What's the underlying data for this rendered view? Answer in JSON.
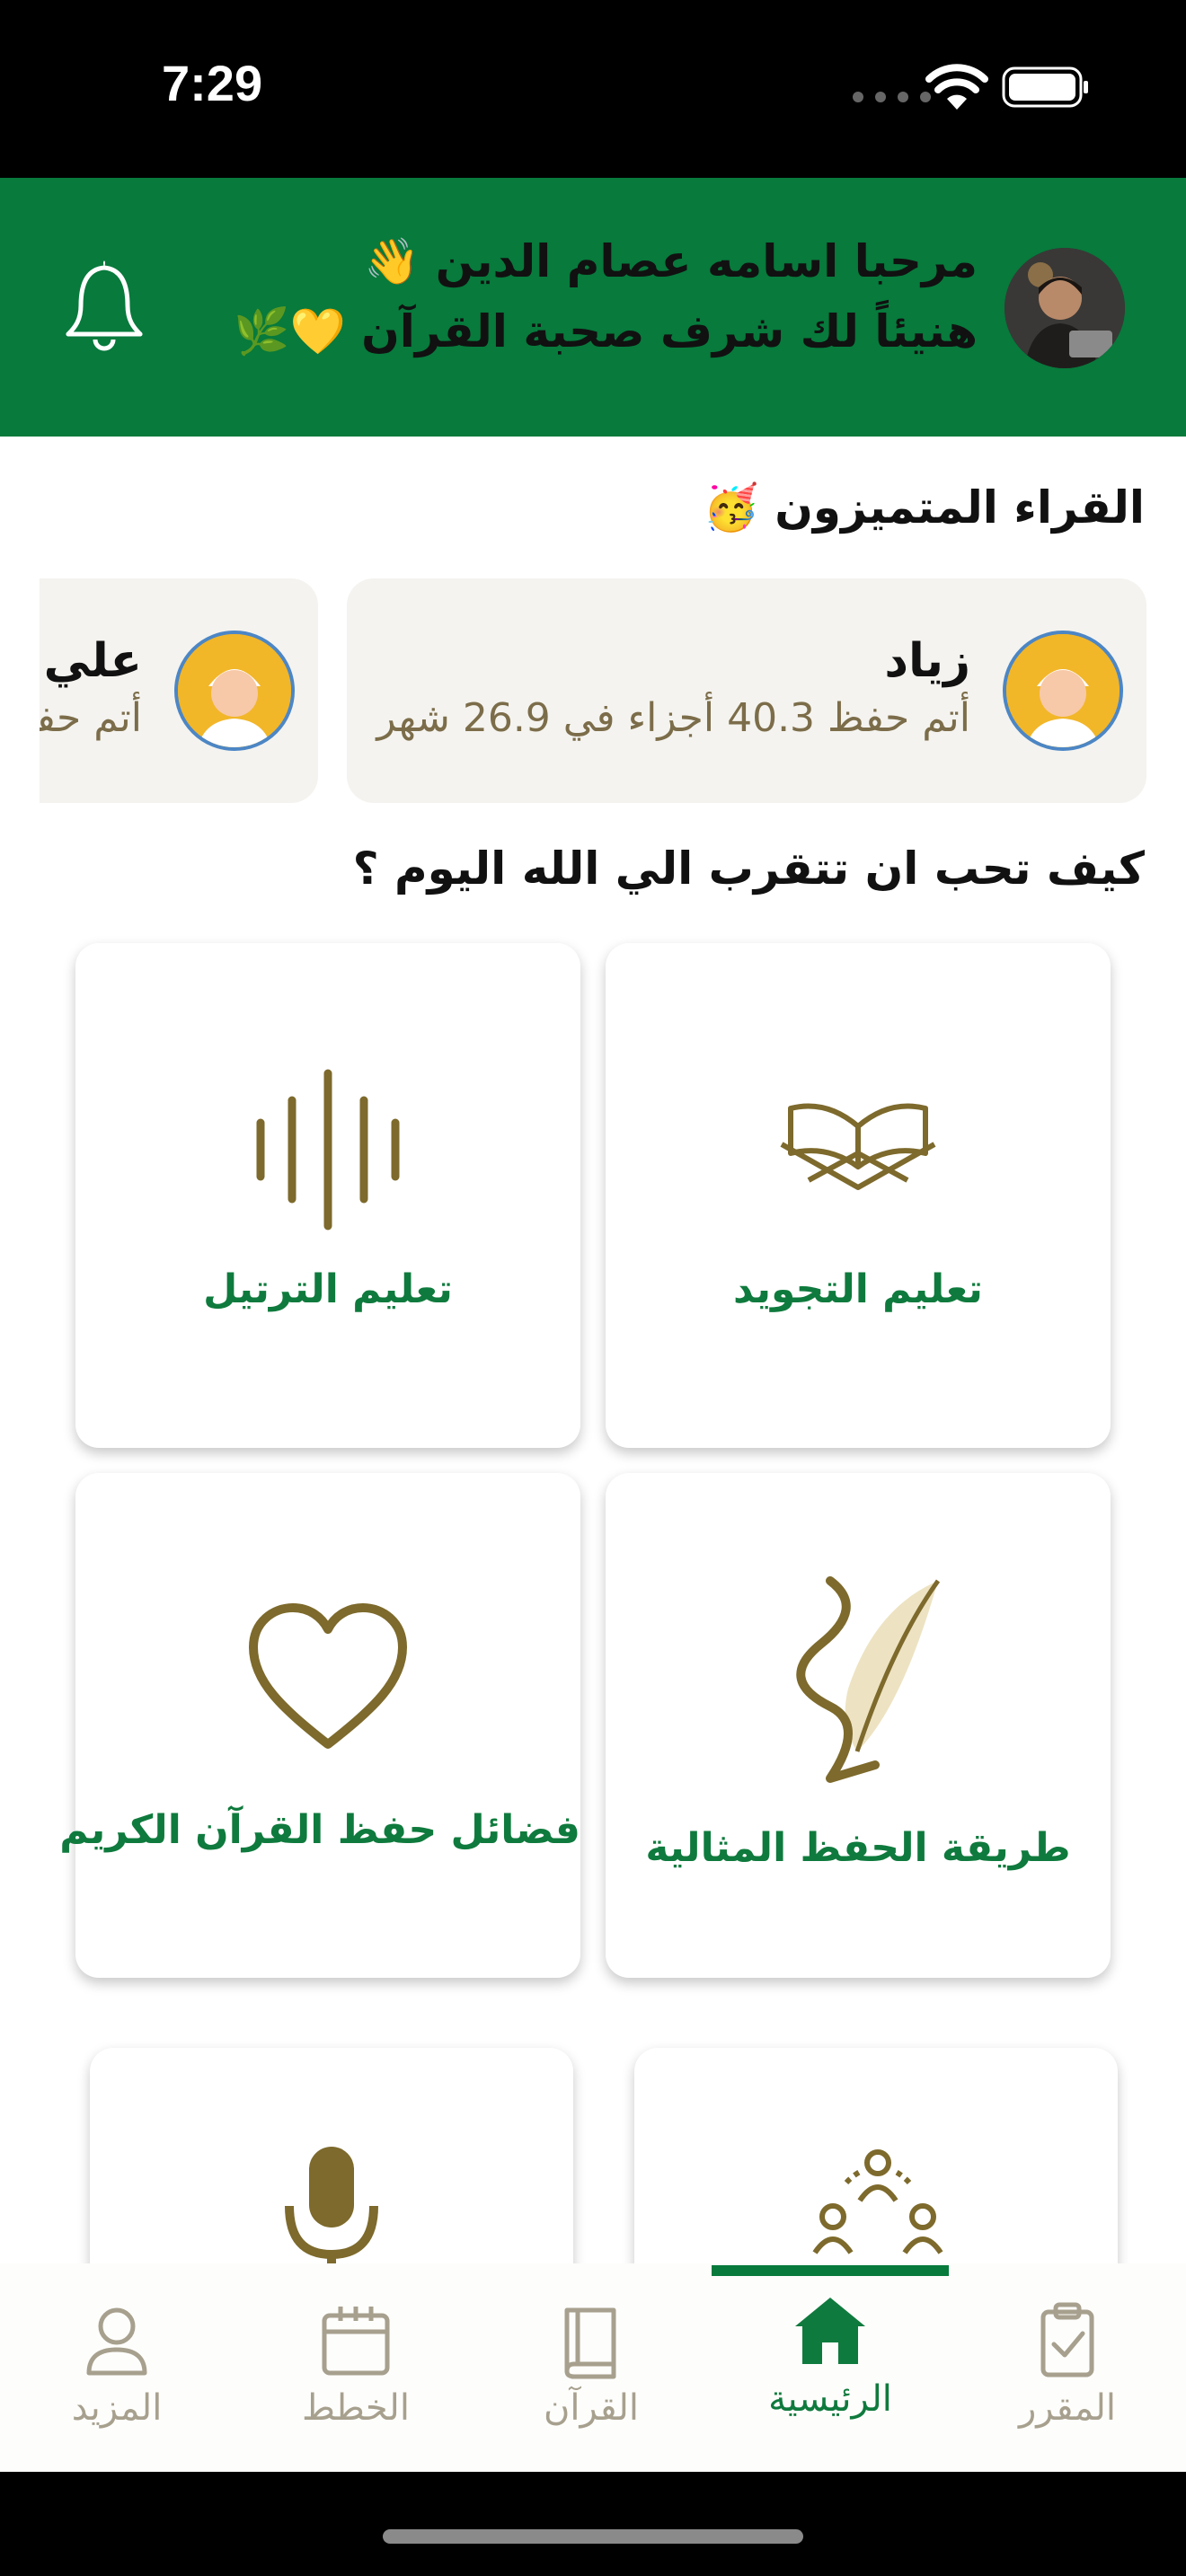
{
  "status_bar": {
    "time": "7:29"
  },
  "header": {
    "greeting": "مرحبا اسامه عصام الدين 👋",
    "subgreeting": "هنيئاً لك شرف صحبة القرآن 💛🌿",
    "bell_icon": "bell-icon"
  },
  "readers_section": {
    "title": "القراء المتميزون 🥳",
    "readers": [
      {
        "name": "زياد",
        "stat": "أتم حفظ 40.3 أجزاء في 26.9 شهر"
      },
      {
        "name": "علي محمد",
        "stat": "أتم حفظ"
      }
    ]
  },
  "approach_section": {
    "title": "كيف تحب ان تتقرب الي الله اليوم ؟",
    "cards": [
      {
        "label": "تعليم التجويد",
        "icon": "quran-stand-icon"
      },
      {
        "label": "تعليم الترتيل",
        "icon": "sound-wave-icon"
      },
      {
        "label": "طريقة الحفظ المثالية",
        "icon": "quill-icon"
      },
      {
        "label": "فضائل حفظ  القرآن الكريم",
        "icon": "heart-icon"
      },
      {
        "label": "",
        "icon": "group-circle-icon"
      },
      {
        "label": "",
        "icon": "microphone-icon"
      }
    ]
  },
  "tab_bar": {
    "tabs": [
      {
        "label": "المقرر",
        "icon": "clipboard-check-icon",
        "active": false
      },
      {
        "label": "الرئيسية",
        "icon": "home-icon",
        "active": true
      },
      {
        "label": "القرآن",
        "icon": "book-icon",
        "active": false
      },
      {
        "label": "الخطط",
        "icon": "calendar-icon",
        "active": false
      },
      {
        "label": "المزيد",
        "icon": "user-icon",
        "active": false
      }
    ]
  },
  "colors": {
    "brand_green": "#077a3c",
    "accent_gold": "#7d6a2c",
    "card_bg": "#f4f3ef",
    "tab_inactive": "#a7a08e"
  }
}
